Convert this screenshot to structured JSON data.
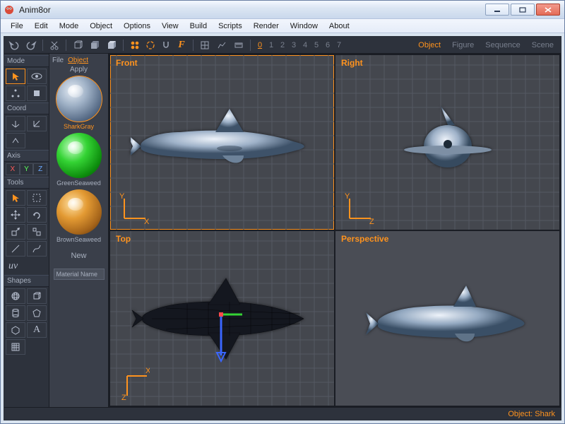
{
  "window": {
    "title": "Anim8or"
  },
  "menu": [
    "File",
    "Edit",
    "Mode",
    "Object",
    "Options",
    "View",
    "Build",
    "Scripts",
    "Render",
    "Window",
    "About"
  ],
  "toolbar": {
    "layers": [
      "0",
      "1",
      "2",
      "3",
      "4",
      "5",
      "6",
      "7"
    ],
    "active_layer": 0,
    "mode_tabs": [
      "Object",
      "Figure",
      "Sequence",
      "Scene"
    ],
    "active_tab": 0
  },
  "toolbox": {
    "sections": {
      "mode": "Mode",
      "coord": "Coord",
      "axis": "Axis",
      "tools": "Tools",
      "shapes": "Shapes"
    },
    "axis": [
      "X",
      "Y",
      "Z"
    ],
    "uv": "uv"
  },
  "materials": {
    "tabs": [
      "File",
      "Object"
    ],
    "active_tab": 1,
    "apply_label": "Apply",
    "list": [
      {
        "name": "SharkGray",
        "cls": "gray",
        "selected": true
      },
      {
        "name": "GreenSeaweed",
        "cls": "green",
        "selected": false
      },
      {
        "name": "BrownSeaweed",
        "cls": "brown",
        "selected": false
      }
    ],
    "new_label": "New",
    "name_input": "Material Name"
  },
  "viewports": [
    {
      "label": "Front",
      "axis_v": "Y",
      "axis_h": "X",
      "grid": true,
      "type": "front",
      "active": true
    },
    {
      "label": "Right",
      "axis_v": "Y",
      "axis_h": "Z",
      "grid": true,
      "type": "right",
      "active": false
    },
    {
      "label": "Top",
      "axis_v": "Z",
      "axis_h": "X",
      "grid": true,
      "type": "top",
      "active": false
    },
    {
      "label": "Perspective",
      "axis_v": "",
      "axis_h": "",
      "grid": false,
      "type": "persp",
      "active": false
    }
  ],
  "status": {
    "label": "Object:",
    "value": "Shark"
  }
}
